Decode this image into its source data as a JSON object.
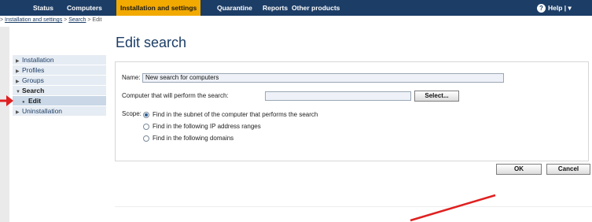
{
  "nav": {
    "items": [
      "Status",
      "Computers",
      "Installation and settings",
      "Quarantine",
      "Reports",
      "Other products"
    ],
    "active_index": 2,
    "help_label": "Help |",
    "help_chevron": "▾"
  },
  "breadcrumb": {
    "sep": ">",
    "items": [
      "Installation and settings",
      "Search",
      "Edit"
    ]
  },
  "sidebar": {
    "items": [
      "Installation",
      "Profiles",
      "Groups",
      "Search",
      "Edit",
      "Uninstallation"
    ],
    "expanded_index": 3,
    "selected_index": 4,
    "collapsed_arrow": "▶",
    "expanded_arrow": "▼",
    "selected_bullet": "●"
  },
  "page": {
    "title": "Edit search"
  },
  "form": {
    "name_label": "Name:",
    "name_value": "New search for computers",
    "computer_label": "Computer that will perform the search:",
    "computer_value": "",
    "select_button": "Select...",
    "scope_label": "Scope:",
    "scope_options": [
      "Find in the subnet of the computer that performs the search",
      "Find in the following IP address ranges",
      "Find in the following domains"
    ],
    "scope_selected": 0
  },
  "actions": {
    "ok": "OK",
    "cancel": "Cancel"
  },
  "colors": {
    "nav_bg": "#1c3d66",
    "nav_active": "#f2a900",
    "annotation_red": "#e02020"
  }
}
